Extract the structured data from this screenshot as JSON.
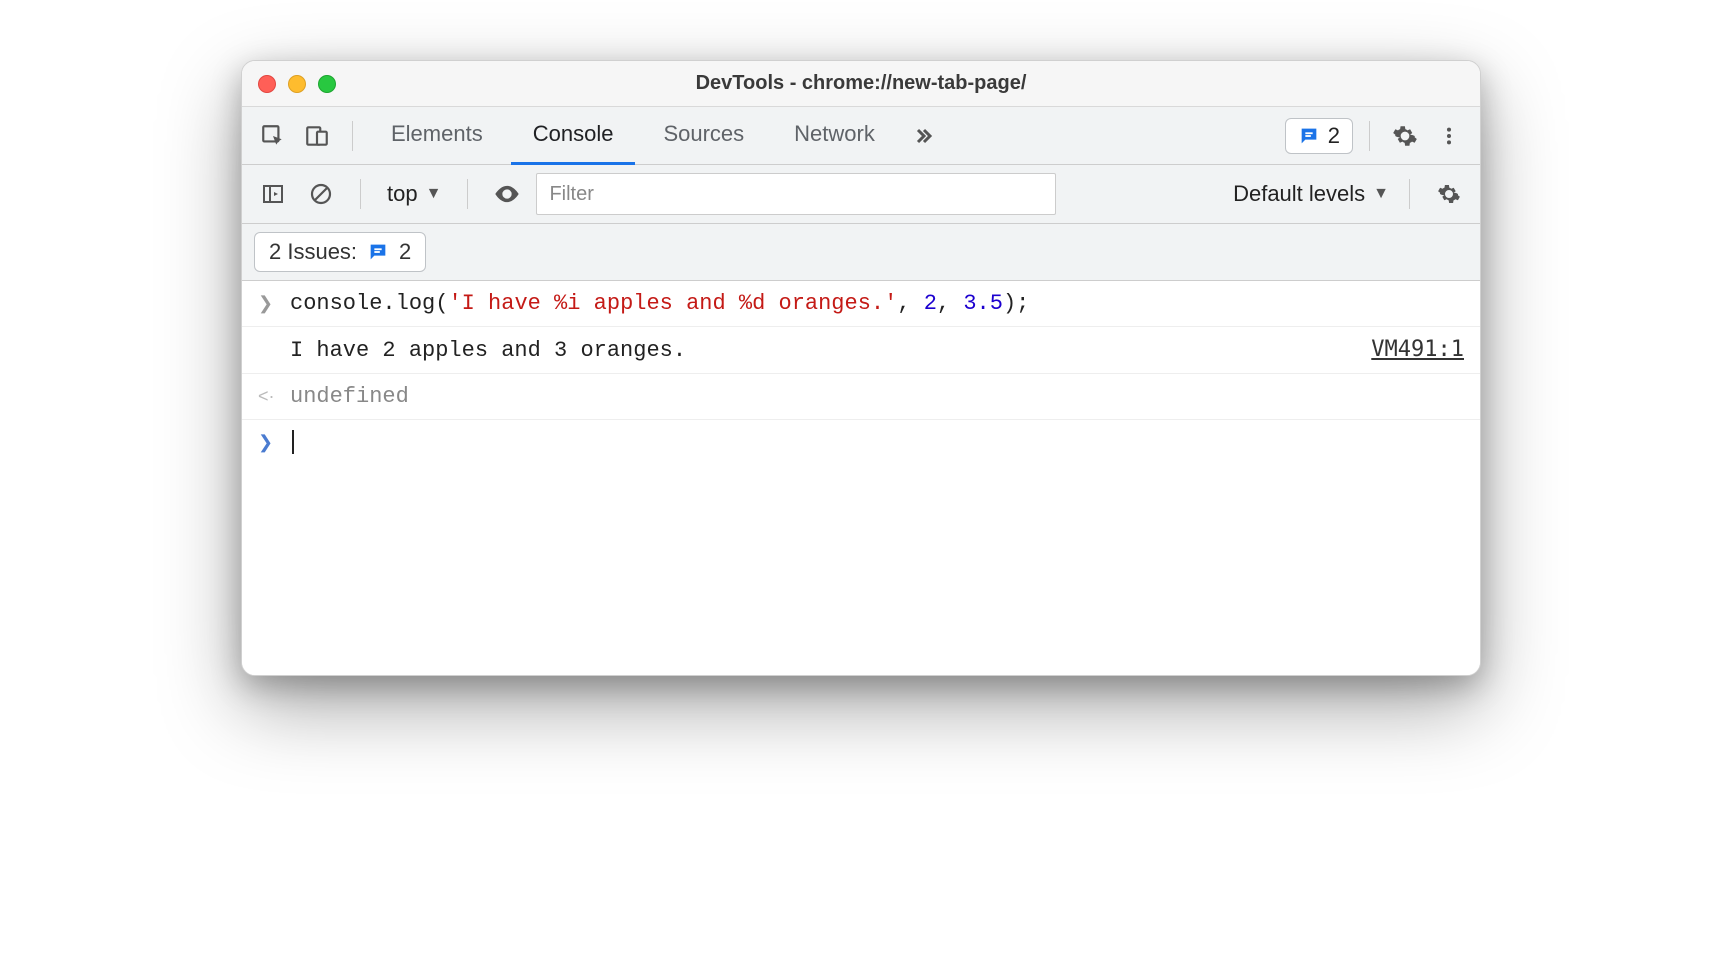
{
  "window": {
    "title": "DevTools - chrome://new-tab-page/"
  },
  "tabs": {
    "elements": "Elements",
    "console": "Console",
    "sources": "Sources",
    "network": "Network"
  },
  "issues_badge": {
    "count": "2"
  },
  "toolbar": {
    "context": "top",
    "filter_placeholder": "Filter",
    "levels": "Default levels"
  },
  "issues_row": {
    "label": "2 Issues:",
    "count": "2"
  },
  "console": {
    "input_fn": "console.log",
    "input_open": "(",
    "input_str": "'I have %i apples and %d oranges.'",
    "input_c1": ", ",
    "input_n1": "2",
    "input_c2": ", ",
    "input_n2": "3.5",
    "input_close": ");",
    "output": "I have 2 apples and 3 oranges.",
    "source": "VM491:1",
    "return": "undefined"
  }
}
